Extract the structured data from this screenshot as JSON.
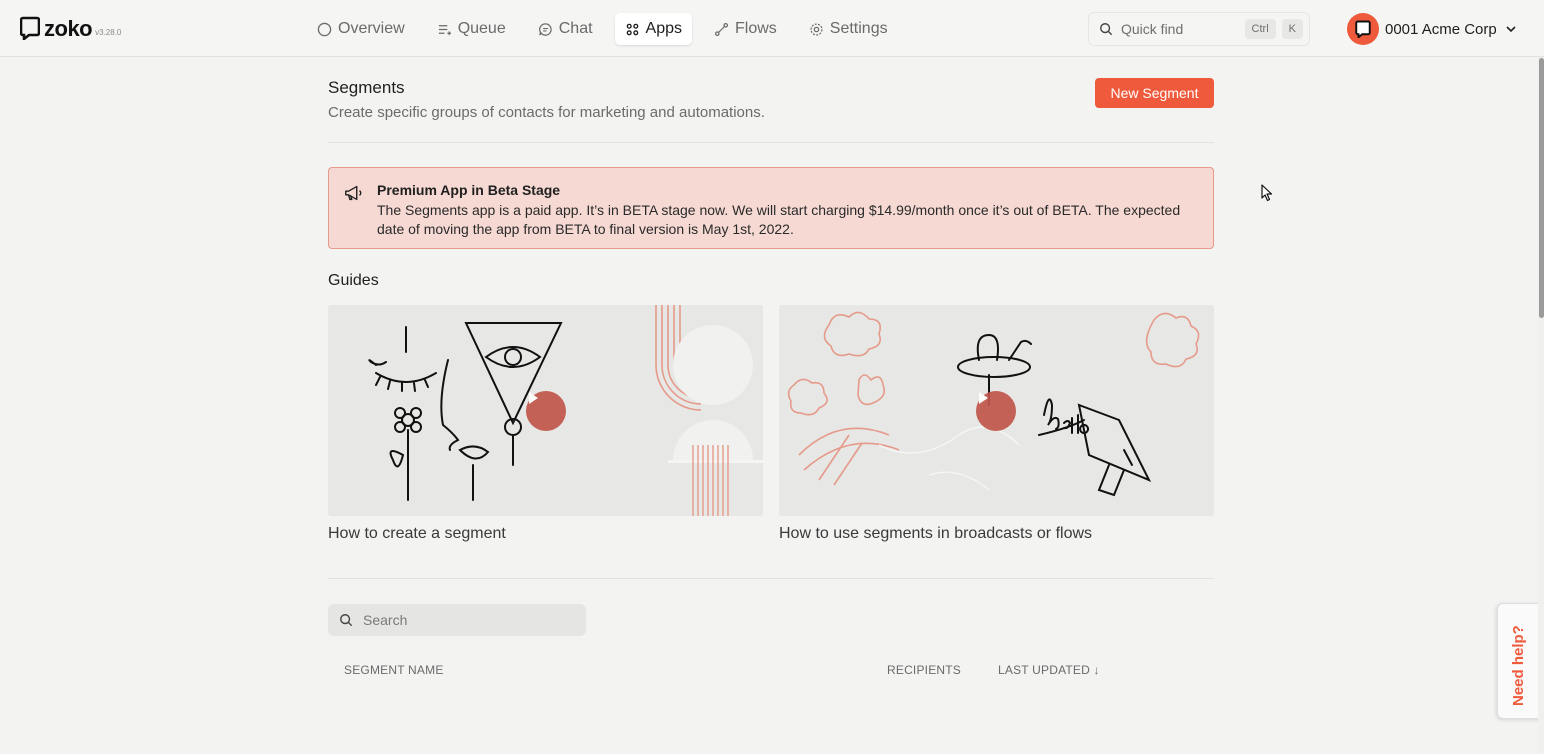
{
  "app": {
    "logo_text": "zoko",
    "version": "v3.28.0"
  },
  "nav": {
    "items": [
      {
        "label": "Overview",
        "icon": "circle-icon"
      },
      {
        "label": "Queue",
        "icon": "queue-icon"
      },
      {
        "label": "Chat",
        "icon": "chat-icon"
      },
      {
        "label": "Apps",
        "icon": "apps-grid-icon",
        "active": true
      },
      {
        "label": "Flows",
        "icon": "flows-icon"
      },
      {
        "label": "Settings",
        "icon": "gear-icon"
      }
    ]
  },
  "quickfind": {
    "placeholder": "Quick find",
    "shortcut_keys": [
      "Ctrl",
      "K"
    ]
  },
  "account": {
    "name": "0001 Acme Corp"
  },
  "page": {
    "title": "Segments",
    "subtitle": "Create specific groups of contacts for marketing and automations.",
    "new_button": "New Segment"
  },
  "alert": {
    "title": "Premium App in Beta Stage",
    "body": "The Segments app is a paid app. It’s in BETA stage now. We will start charging $14.99/month once it’s out of BETA. The expected date of moving the app from BETA to final version is May 1st, 2022."
  },
  "guides": {
    "title": "Guides",
    "items": [
      {
        "label": "How to create a segment"
      },
      {
        "label": "How to use segments in broadcasts or flows"
      }
    ]
  },
  "segments": {
    "search_placeholder": "Search",
    "columns": {
      "name": "SEGMENT NAME",
      "recipients": "RECIPIENTS",
      "last_updated": "LAST UPDATED ↓"
    }
  },
  "help": {
    "label": "Need help?"
  },
  "colors": {
    "accent": "#ef5a3c",
    "alert_bg": "#f6d9d3",
    "alert_border": "#e79a8b"
  }
}
